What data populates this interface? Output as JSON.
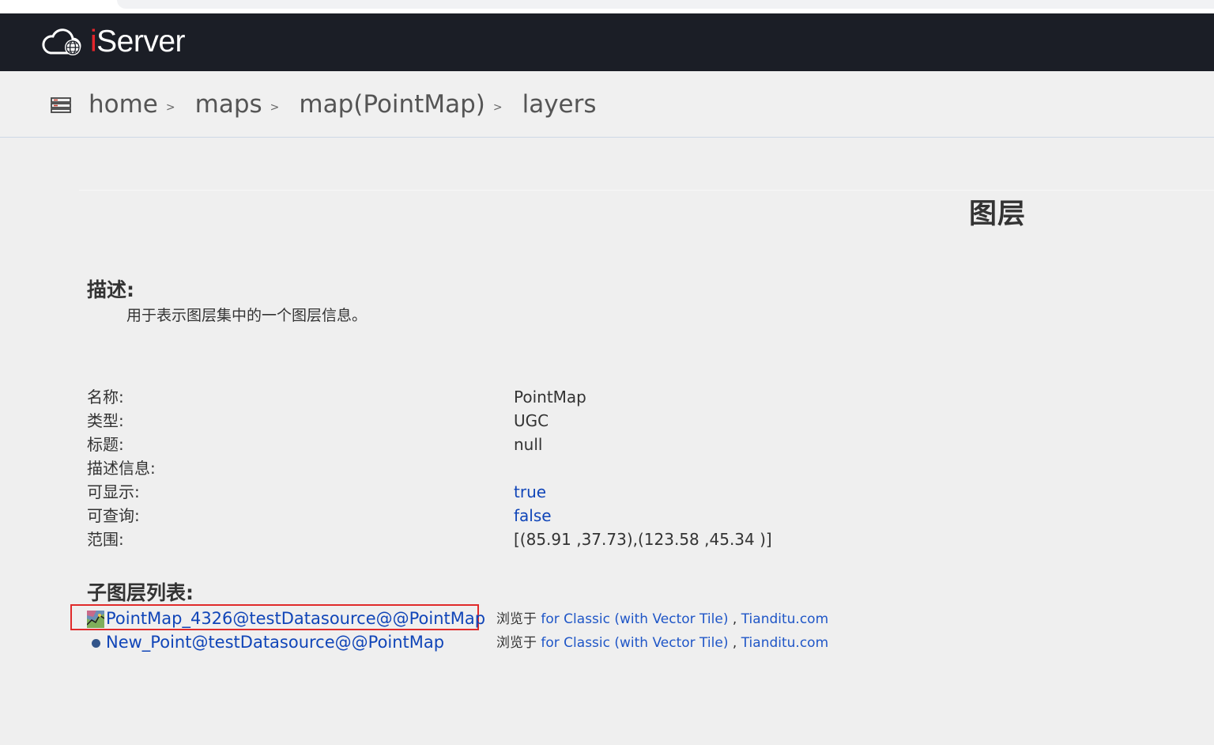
{
  "header": {
    "logo_i": "i",
    "logo_rest": "Server"
  },
  "breadcrumb": {
    "icon": "server-stack-icon",
    "items": [
      "home",
      "maps",
      "map(PointMap)",
      "layers"
    ],
    "separator": ">"
  },
  "page": {
    "title": "图层"
  },
  "description": {
    "heading": "描述:",
    "text": "用于表示图层集中的一个图层信息。"
  },
  "properties": [
    {
      "label": "名称:",
      "value": "PointMap",
      "is_link": false
    },
    {
      "label": "类型:",
      "value": "UGC",
      "is_link": false
    },
    {
      "label": "标题:",
      "value": "null",
      "is_link": false
    },
    {
      "label": "描述信息:",
      "value": "",
      "is_link": false
    },
    {
      "label": "可显示:",
      "value": "true",
      "is_link": true
    },
    {
      "label": "可查询:",
      "value": "false",
      "is_link": true
    },
    {
      "label": "范围:",
      "value": "[(85.91 ,37.73),(123.58 ,45.34 )]",
      "is_link": false
    }
  ],
  "sublayers": {
    "heading": "子图层列表:",
    "items": [
      {
        "icon": "layer-thumbnail-icon",
        "name": "PointMap_4326@testDatasource@@PointMap",
        "browse_prefix": "浏览于",
        "browse_link1": "for Classic (with Vector Tile)",
        "browse_sep": ",",
        "browse_link2": "Tianditu.com",
        "highlighted": true
      },
      {
        "icon": "point-dot-icon",
        "name": "New_Point@testDatasource@@PointMap",
        "browse_prefix": "浏览于",
        "browse_link1": "for Classic (with Vector Tile)",
        "browse_sep": ",",
        "browse_link2": "Tianditu.com",
        "highlighted": false
      }
    ]
  },
  "colors": {
    "topbar": "#1b1e26",
    "link": "#1045b8",
    "highlight": "#e02b2b",
    "logo_accent": "#e4252b"
  }
}
